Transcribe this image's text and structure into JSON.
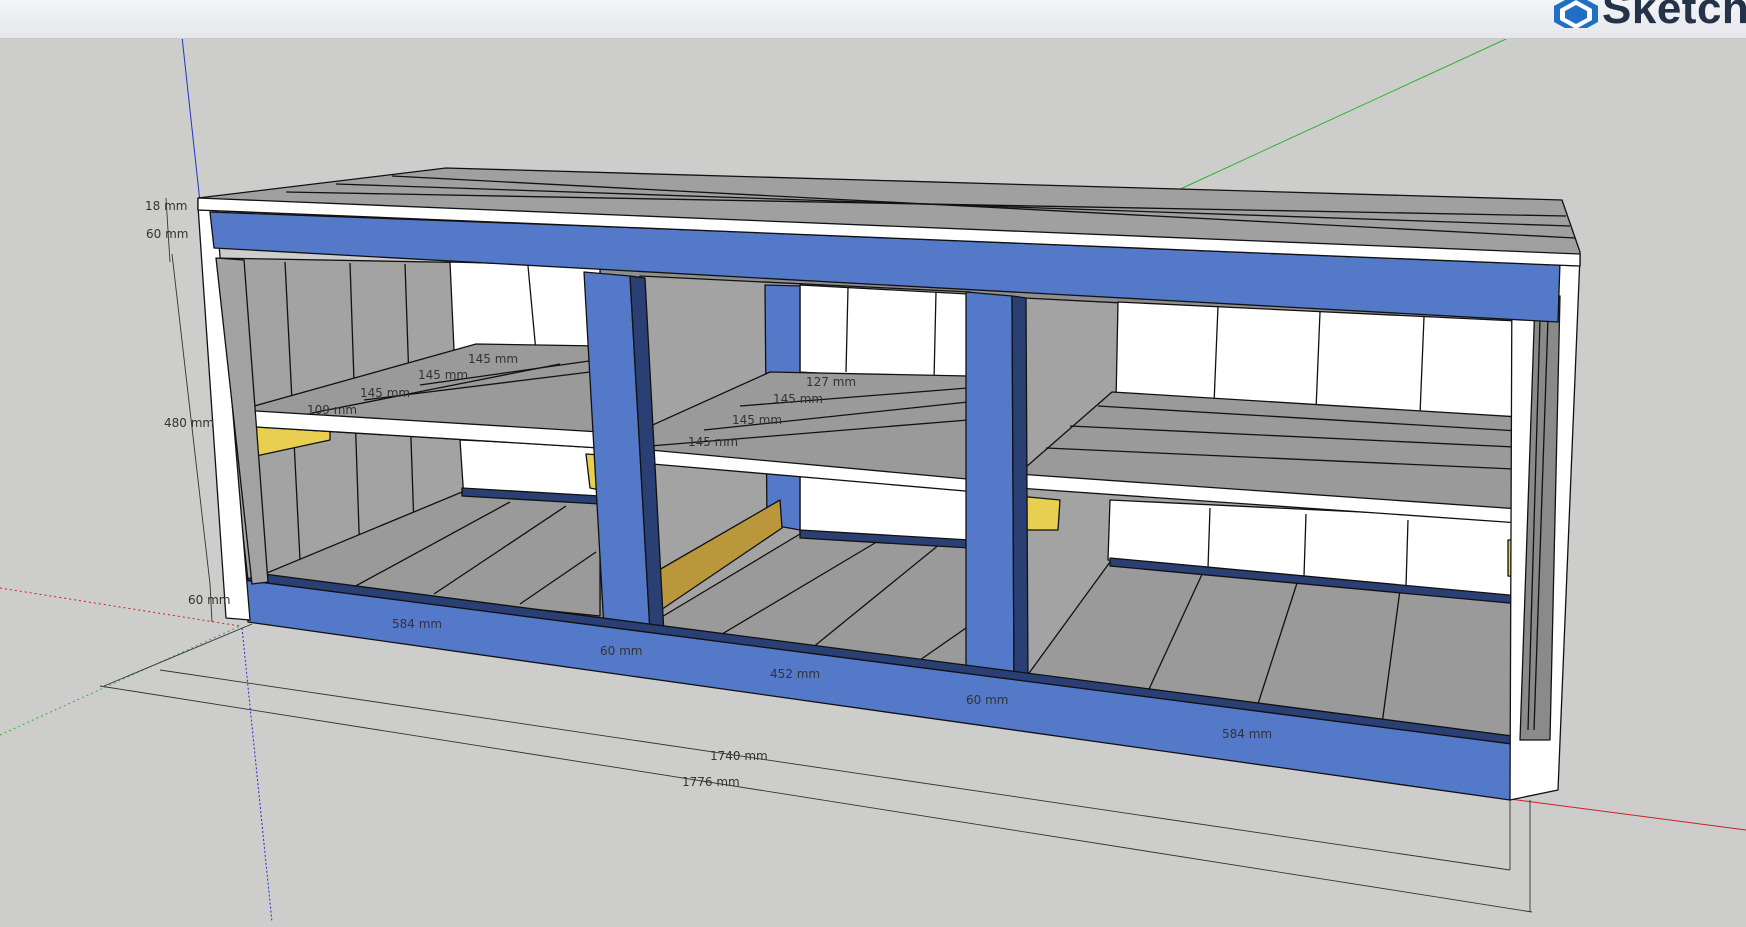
{
  "app": {
    "brand_name": "Sketch",
    "brand_icon": "sketchup-logo-icon"
  },
  "colors": {
    "canvas_background": "#cdcdcb",
    "frame_blue": "#5479c9",
    "frame_blue_dark": "#2a3f73",
    "shelf_grey": "#9a9a9a",
    "panel_white": "#ffffff",
    "cleat_yellow": "#e8cf4f",
    "axis_red": "#cc2222",
    "axis_green": "#2bb52b",
    "axis_blue": "#2233cc"
  },
  "dimensions": {
    "top_thickness": "18 mm",
    "top_rail": "60 mm",
    "side_height": "480 mm",
    "bottom_rail": "60 mm",
    "bay_left": "584 mm",
    "post_left": "60 mm",
    "bay_middle": "452 mm",
    "post_right": "60 mm",
    "bay_right": "584 mm",
    "inner_length": "1740 mm",
    "overall_length": "1776 mm",
    "left_shelf_1": "145 mm",
    "left_shelf_2": "145 mm",
    "left_shelf_3": "145 mm",
    "left_shelf_4": "109 mm",
    "middle_shelf_1": "127 mm",
    "middle_shelf_2": "145 mm",
    "middle_shelf_3": "145 mm",
    "middle_shelf_4": "145 mm"
  }
}
